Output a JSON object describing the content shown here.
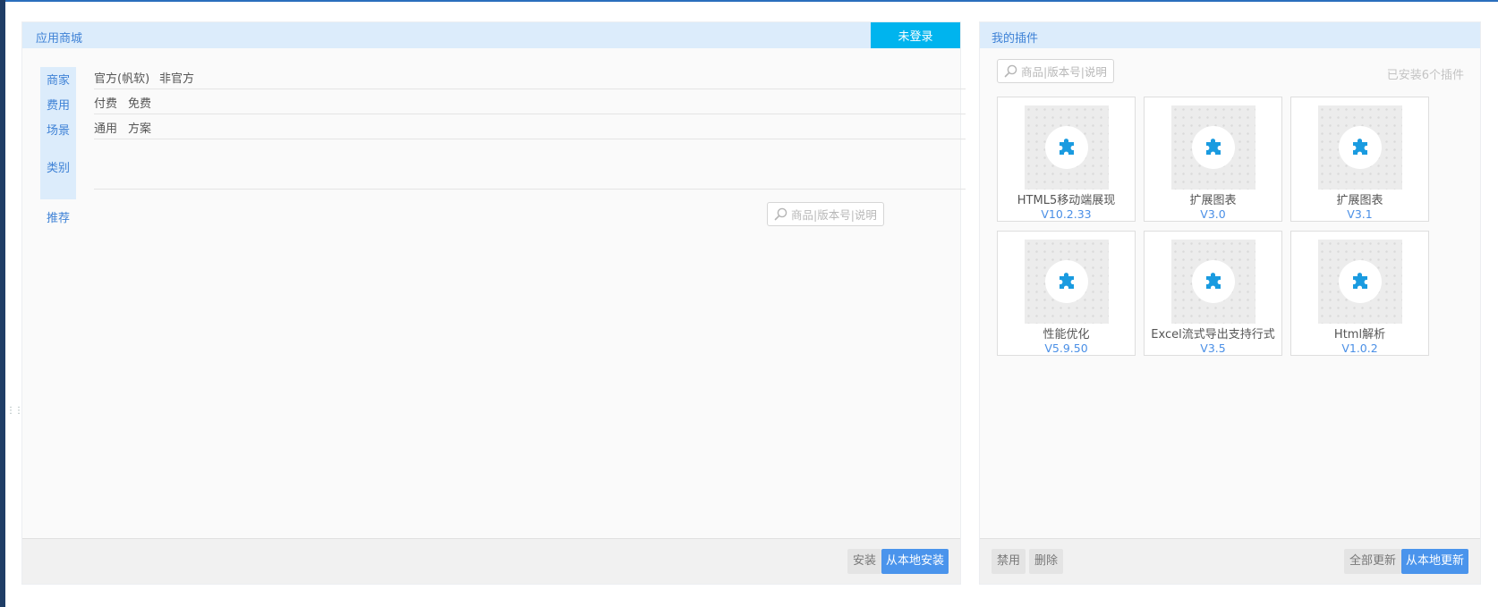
{
  "store": {
    "title": "应用商城",
    "login_label": "未登录",
    "filters": [
      {
        "label": "商家",
        "options": [
          "官方(帆软)",
          "非官方"
        ]
      },
      {
        "label": "费用",
        "options": [
          "付费",
          "免费"
        ]
      },
      {
        "label": "场景",
        "options": [
          "通用",
          "方案"
        ]
      },
      {
        "label": "类别",
        "options": []
      }
    ],
    "recommend_label": "推荐",
    "search_placeholder": "商品|版本号|说明",
    "install_label": "安装",
    "install_local_label": "从本地安装"
  },
  "plugins": {
    "title": "我的插件",
    "search_placeholder": "商品|版本号|说明",
    "installed_count_text": "已安装6个插件",
    "items": [
      {
        "name": "HTML5移动端展现",
        "version": "V10.2.33"
      },
      {
        "name": "扩展图表",
        "version": "V3.0"
      },
      {
        "name": "扩展图表",
        "version": "V3.1"
      },
      {
        "name": "性能优化",
        "version": "V5.9.50"
      },
      {
        "name": "Excel流式导出支持行式",
        "version": "V3.5"
      },
      {
        "name": "Html解析",
        "version": "V1.0.2"
      }
    ],
    "disable_label": "禁用",
    "delete_label": "删除",
    "update_all_label": "全部更新",
    "update_local_label": "从本地更新"
  },
  "icons": {
    "search": "search-icon",
    "plugin": "puzzle-piece-icon",
    "grip": "drag-handle-icon"
  },
  "colors": {
    "accent": "#3f82d6",
    "header_bg": "#dcecfb",
    "login_bg": "#00b4ee",
    "primary_button": "#4a94ec",
    "plugin_icon": "#1a9be0"
  }
}
